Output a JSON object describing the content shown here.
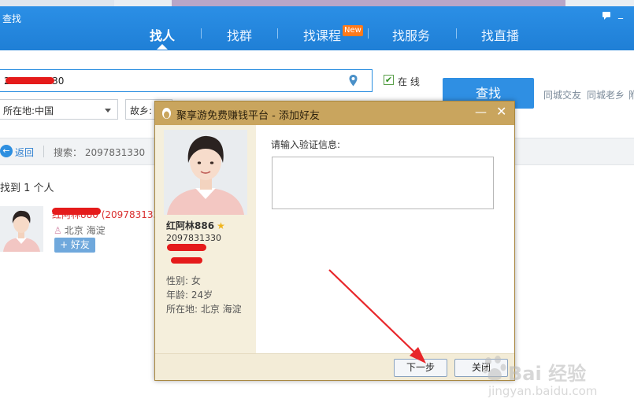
{
  "app": {
    "title": "查找",
    "accent_color": "#1f7fd6",
    "icons": [
      "message-icon",
      "minimize-icon",
      "close-icon"
    ]
  },
  "tabs": [
    {
      "label": "找人",
      "active": true
    },
    {
      "label": "找群",
      "active": false
    },
    {
      "label": "找课程",
      "active": false,
      "badge": "New"
    },
    {
      "label": "找服务",
      "active": false
    },
    {
      "label": "找直播",
      "active": false
    }
  ],
  "search": {
    "value": "2097831330",
    "online_checked": true,
    "online_label": "在 线",
    "find_button": "查找",
    "links": [
      "同城交友",
      "同城老乡",
      "附"
    ],
    "location_select": "所在地:中国",
    "hometown_select": "故乡:"
  },
  "back_bar": {
    "back_label": "返回",
    "summary": "搜索： 2097831330"
  },
  "results": {
    "count_text": "找到 1 个人",
    "items": [
      {
        "name": "红阿林880 (209783133",
        "location": "北京 海淀",
        "add_button": "+ 好友"
      }
    ]
  },
  "dialog": {
    "title": "聚享游免费赚钱平台 - 添加好友",
    "title_color": "#c9a55e",
    "profile": {
      "name": "红阿林886",
      "qq": "2097831330",
      "gender": "性别: 女",
      "age": "年龄: 24岁",
      "location": "所在地: 北京  海淀"
    },
    "verify_label": "请输入验证信息:",
    "verify_value": "",
    "next_button": "下一步",
    "close_button": "关闭"
  },
  "watermark": {
    "brand": "Bai 经验",
    "url": "jingyan.baidu.com"
  }
}
